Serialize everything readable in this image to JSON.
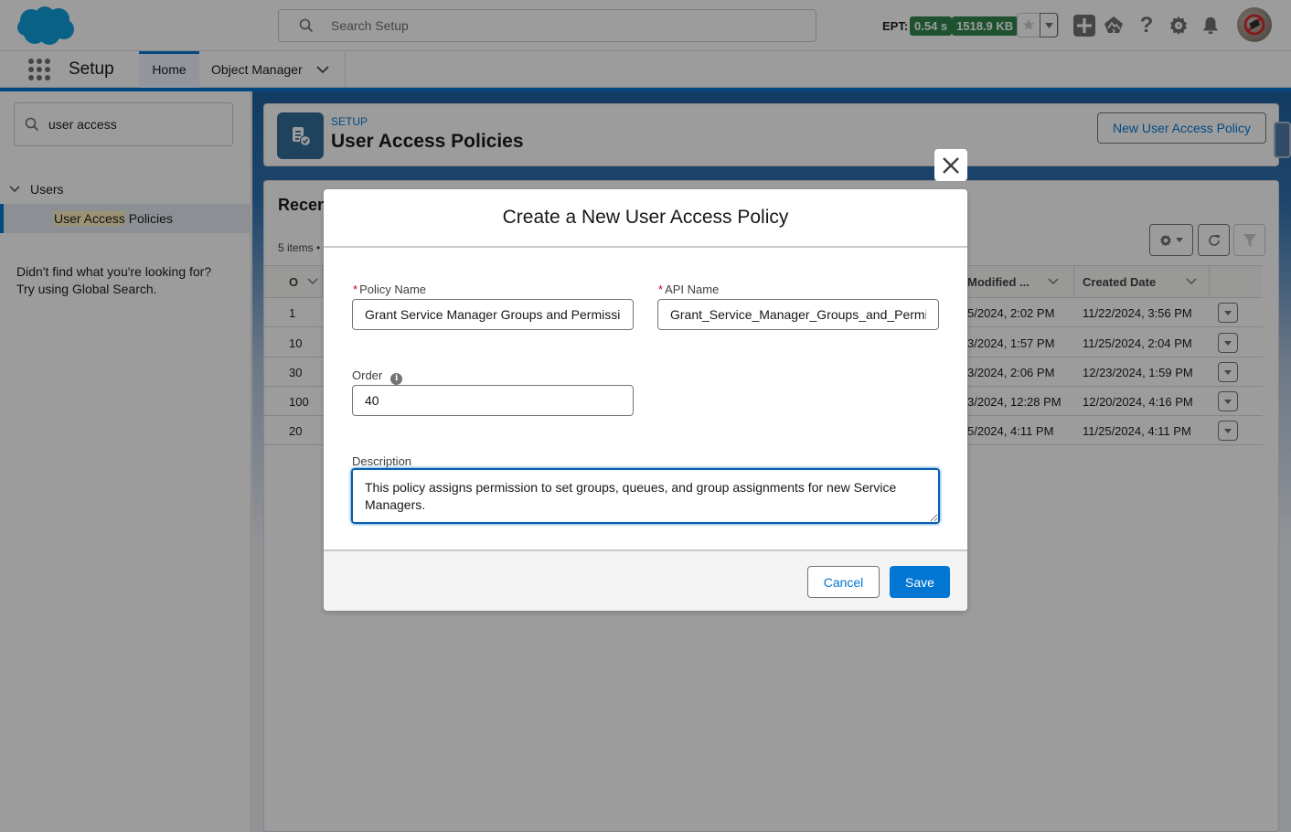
{
  "header": {
    "search_placeholder": "Search Setup",
    "ept_label": "EPT:",
    "ept_time": "0.54 s",
    "ept_size": "1518.9 KB",
    "colors": {
      "brand": "#0176d3",
      "ept_badge": "#2e844a"
    }
  },
  "context_bar": {
    "app_name": "Setup",
    "tabs": [
      {
        "label": "Home",
        "active": true
      },
      {
        "label": "Object Manager",
        "active": false
      }
    ]
  },
  "sidebar": {
    "quickfind_value": "user access",
    "tree_parent": "Users",
    "tree_child_highlight": "User Access",
    "tree_child_rest": " Policies",
    "not_found_line1": "Didn't find what you're looking for?",
    "not_found_line2": "Try using Global Search."
  },
  "page_header": {
    "eyebrow": "SETUP",
    "title": "User Access Policies",
    "new_button": "New User Access Policy"
  },
  "list": {
    "title": "Recen",
    "meta": "5 items •",
    "columns": [
      "O",
      "Modified ...",
      "Created Date"
    ],
    "rows": [
      {
        "order": "1",
        "modified": "5/2024, 2:02 PM",
        "created": "11/22/2024, 3:56 PM"
      },
      {
        "order": "10",
        "modified": "3/2024, 1:57 PM",
        "created": "11/25/2024, 2:04 PM"
      },
      {
        "order": "30",
        "modified": "3/2024, 2:06 PM",
        "created": "12/23/2024, 1:59 PM"
      },
      {
        "order": "100",
        "modified": "3/2024, 12:28 PM",
        "created": "12/20/2024, 4:16 PM"
      },
      {
        "order": "20",
        "modified": "5/2024, 4:11 PM",
        "created": "11/25/2024, 4:11 PM"
      }
    ]
  },
  "modal": {
    "title": "Create a New User Access Policy",
    "policy_name_label": "Policy Name",
    "policy_name_value": "Grant Service Manager Groups and Permissi",
    "api_name_label": "API Name",
    "api_name_value": "Grant_Service_Manager_Groups_and_Permis",
    "order_label": "Order",
    "order_value": "40",
    "description_label": "Description",
    "description_value": "This policy assigns permission to set groups, queues, and group assignments for new Service Managers.",
    "required_marker": "*",
    "info_glyph": "i",
    "cancel_label": "Cancel",
    "save_label": "Save"
  }
}
